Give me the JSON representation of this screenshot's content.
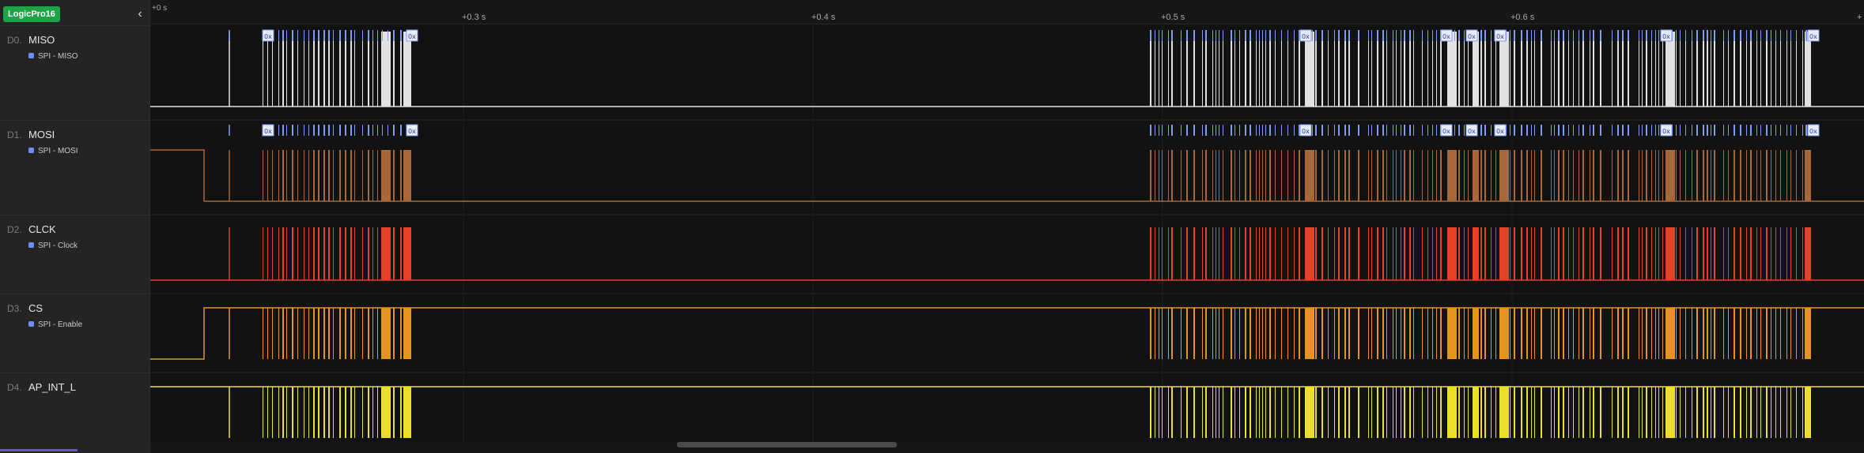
{
  "device": {
    "name": "LogicPro16"
  },
  "sidebar": {
    "collapse_icon": "chevron-left-icon",
    "collapse_glyph": "‹"
  },
  "timeline": {
    "start_label": "+0 s",
    "ticks": [
      {
        "label": "+0.3 s"
      },
      {
        "label": "+0.4 s"
      },
      {
        "label": "+0.5 s"
      },
      {
        "label": "+0.6 s"
      },
      {
        "label": "+"
      }
    ]
  },
  "channels": [
    {
      "index": "D0.",
      "name": "MISO",
      "analyzer": "SPI - MISO",
      "color": "#e2e2e2"
    },
    {
      "index": "D1.",
      "name": "MOSI",
      "analyzer": "SPI - MOSI",
      "color": "#a8683a"
    },
    {
      "index": "D2.",
      "name": "CLCK",
      "analyzer": "SPI - Clock",
      "color": "#e8412a"
    },
    {
      "index": "D3.",
      "name": "CS",
      "analyzer": "SPI - Enable",
      "color": "#e69420"
    },
    {
      "index": "D4.",
      "name": "AP_INT_L",
      "analyzer": "",
      "color": "#ecdf2c"
    }
  ],
  "protocol_marker_label": "0x",
  "colors": {
    "analyzer_dot": "#6f8ff0",
    "decode_bar": "#7f9cf5",
    "app_badge": "#1ea446",
    "accent": "#6a4fd8"
  }
}
